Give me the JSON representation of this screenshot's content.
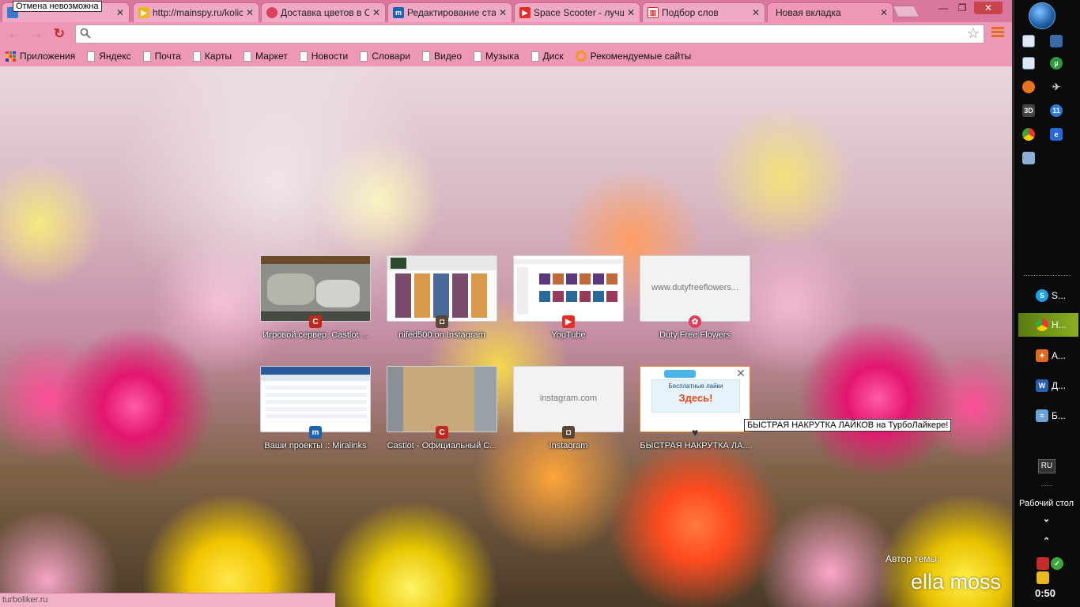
{
  "tabs": [
    {
      "title": "",
      "favicon": "chrome-tab-icon",
      "favicon_color": "#3a7bd5"
    },
    {
      "title": "http://mainspy.ru/kolic",
      "favicon": "mainspy-icon",
      "favicon_color": "#f1b51c"
    },
    {
      "title": "Доставка цветов в С",
      "favicon": "flowers-icon",
      "favicon_color": "#e0405a"
    },
    {
      "title": "Редактирование ста",
      "favicon": "miralinks-icon",
      "favicon_color": "#1c64b0"
    },
    {
      "title": "Space Scooter - лучш",
      "favicon": "youtube-icon",
      "favicon_color": "#e52d27"
    },
    {
      "title": "Подбор слов",
      "favicon": "stats-icon",
      "favicon_color": "#d0302d"
    },
    {
      "title": "Новая вкладка",
      "favicon": "",
      "favicon_color": ""
    }
  ],
  "tab_close_glyph": "✕",
  "window_controls": {
    "minimize": "—",
    "restore": "❐",
    "close": "✕"
  },
  "undo_tooltip": "Отмена невозможна",
  "omnibox": {
    "value": "",
    "placeholder": ""
  },
  "bookmarks": [
    {
      "label": "Приложения",
      "icon": "apps-grid-icon"
    },
    {
      "label": "Яндекс",
      "icon": "page-icon"
    },
    {
      "label": "Почта",
      "icon": "page-icon"
    },
    {
      "label": "Карты",
      "icon": "page-icon"
    },
    {
      "label": "Маркет",
      "icon": "page-icon"
    },
    {
      "label": "Новости",
      "icon": "page-icon"
    },
    {
      "label": "Словари",
      "icon": "page-icon"
    },
    {
      "label": "Видео",
      "icon": "page-icon"
    },
    {
      "label": "Музыка",
      "icon": "page-icon"
    },
    {
      "label": "Диск",
      "icon": "page-icon"
    },
    {
      "label": "Рекомендуемые сайты",
      "icon": "bing-ring-icon"
    }
  ],
  "tiles": [
    {
      "label": "Игровой сервер. Castlot ...",
      "domain": "",
      "favicon": "castlot-icon",
      "favicon_letter": "C",
      "favicon_color": "#c0281e"
    },
    {
      "label": "nifed500 on Instagram",
      "domain": "",
      "favicon": "instagram-icon",
      "favicon_letter": "◘",
      "favicon_color": "#5a4636"
    },
    {
      "label": "YouTube",
      "domain": "",
      "favicon": "youtube-icon",
      "favicon_letter": "▶",
      "favicon_color": "#e52d27"
    },
    {
      "label": "Duty Free Flowers",
      "domain": "www.dutyfreeflowers...",
      "favicon": "flowers-icon",
      "favicon_letter": "✿",
      "favicon_color": "#e0405a"
    },
    {
      "label": "Ваши проекты :: Miralinks",
      "domain": "",
      "favicon": "miralinks-icon",
      "favicon_letter": "m",
      "favicon_color": "#1c64b0"
    },
    {
      "label": "Castlot - Официальный С...",
      "domain": "",
      "favicon": "castlot-icon",
      "favicon_letter": "C",
      "favicon_color": "#c0281e"
    },
    {
      "label": "Instagram",
      "domain": "instagram.com",
      "favicon": "instagram-icon",
      "favicon_letter": "◘",
      "favicon_color": "#5a4636"
    },
    {
      "label": "БЫСТРАЯ НАКРУТКА ЛА...",
      "domain": "",
      "favicon": "heart-icon",
      "favicon_letter": "♥",
      "favicon_color": "#333333"
    }
  ],
  "tile_close_glyph": "✕",
  "turbo_tile_text": {
    "line1": "Бесплатные лайки",
    "line2": "Здесь!"
  },
  "hover_tooltip": "БЫСТРАЯ НАКРУТКА ЛАЙКОВ на ТурбоЛайкере!",
  "theme_author_label": "Автор темы:",
  "theme_name": "ella moss",
  "status_url": "turboliker.ru",
  "taskbar": {
    "tasks": [
      {
        "label": "S...",
        "icon": "skype-icon",
        "color": "#1aa3e8",
        "letter": "S"
      },
      {
        "label": "Н...",
        "icon": "chrome-icon",
        "color": "#3a9a3a",
        "letter": "●"
      },
      {
        "label": "А...",
        "icon": "avast-icon",
        "color": "#e06a1e",
        "letter": "A"
      },
      {
        "label": "Д...",
        "icon": "word-icon",
        "color": "#2b5fb3",
        "letter": "W"
      },
      {
        "label": "Б...",
        "icon": "notepad-icon",
        "color": "#6aa3d8",
        "letter": "≡"
      }
    ],
    "lang": "RU",
    "desktop_label": "Рабочий стол",
    "clock": "0:50"
  },
  "colors": {
    "accent": "#ee97b6",
    "taskbar": "#0b0b0b",
    "active_task": "#7a9a1a"
  }
}
